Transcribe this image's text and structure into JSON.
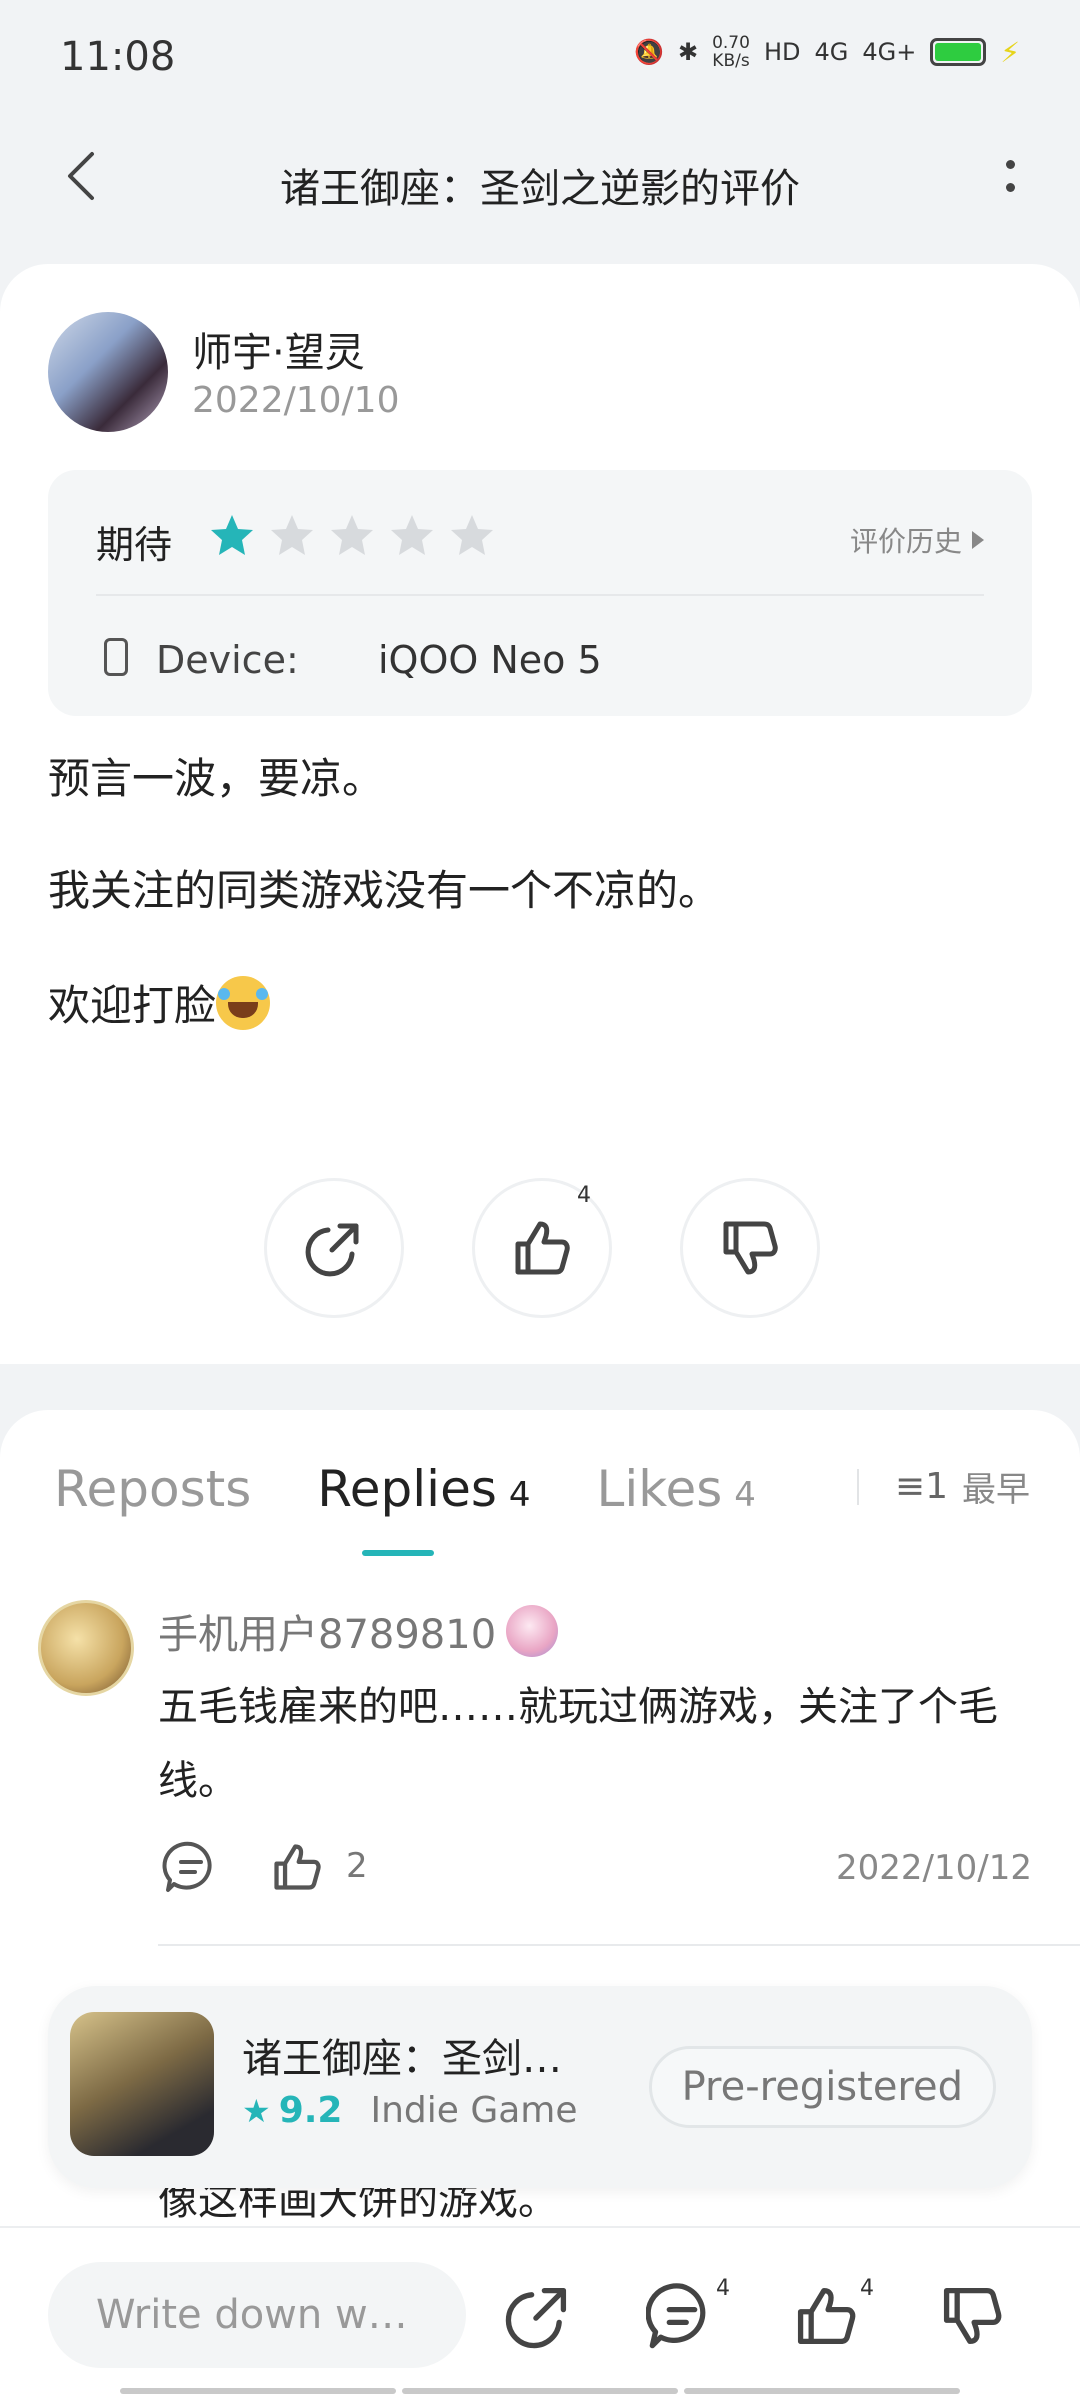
{
  "status_bar": {
    "time": "11:08",
    "speed_value": "0.70",
    "speed_unit": "KB/s",
    "hd": "HD",
    "net1": "4G",
    "net2": "4G+"
  },
  "nav": {
    "title": "诸王御座：圣剑之逆影的评价"
  },
  "review": {
    "author": "师宇·望灵",
    "date": "2022/10/10",
    "rating_label": "期待",
    "rating": 1,
    "rating_max": 5,
    "history_label": "评价历史",
    "device_label": "Device:",
    "device_value": "iQOO Neo 5",
    "paragraphs": [
      "预言一波，要凉。",
      "我关注的同类游戏没有一个不凉的。",
      "欢迎打脸"
    ],
    "like_count": "4",
    "accent_color": "#25b5b8"
  },
  "tabs": {
    "reposts": "Reposts",
    "replies": "Replies",
    "replies_count": "4",
    "likes": "Likes",
    "likes_count": "4",
    "sort_label": "最早",
    "sort_icon_text": "≡1"
  },
  "reply": {
    "user": "手机用户8789810",
    "text": "五毛钱雇来的吧……就玩过俩游戏，关注了个毛线。",
    "like_count": "2",
    "date": "2022/10/12"
  },
  "partial_reply_text": "像这样画大饼的游戏。",
  "game_card": {
    "title": "诸王御座：圣剑…",
    "score": "9.2",
    "genre": "Indie Game",
    "button": "Pre-registered"
  },
  "bottom_bar": {
    "input_placeholder": "Write down w…",
    "comment_count": "4",
    "like_count": "4"
  }
}
